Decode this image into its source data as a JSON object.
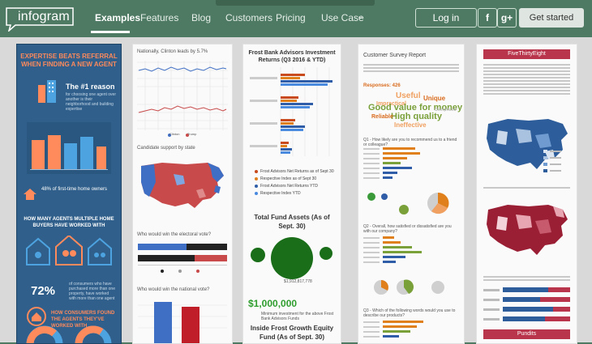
{
  "nav": {
    "logo": "infogram",
    "links": [
      "Examples",
      "Features",
      "Blog",
      "Customers",
      "Pricing",
      "Use Case"
    ],
    "login": "Log in",
    "facebook": "f",
    "google": "g+",
    "cta": "Get started"
  },
  "cards": {
    "c1": {
      "title": "EXPERTISE BEATS REFERRAL WHEN FINDING A NEW AGENT",
      "reason": "The #1 reason",
      "reason_sub": "for choosing one agent over another is their neighborhood and building expertise",
      "stat48": "48% of first-time home owners",
      "how_many": "HOW MANY AGENTS MULTIPLE HOME BUYERS HAVE WORKED WITH",
      "pct72": "72%",
      "pct72_sub": "of consumers who have purchased more than one property, have worked with more than one agent",
      "how_found": "HOW CONSUMERS FOUND THE AGENTS THEY'VE WORKED WITH"
    },
    "c2": {
      "chart_title": "Nationally, Clinton leads by 5.7%",
      "map_title": "Candidate support by state",
      "electoral_title": "Who would win the electoral vote?",
      "national_title": "Who would win the national vote?",
      "legend_clinton": "Clinton",
      "legend_trump": "Trump"
    },
    "c3": {
      "title": "Frost Bank Advisors Investment Returns (Q3 2016 & YTD)",
      "legend": [
        "Frost Advisors Net Returns as of Sept 30",
        "Respective Index as of Sept 30",
        "Frost Advisors Net Returns YTD",
        "Respective Index YTD"
      ],
      "total_title": "Total Fund Assets (As of Sept. 30)",
      "big_amount": "$1,000,000",
      "big_sub": "Minimum investment for the above Frost Bank Advisors Funds",
      "growth_title": "Inside Frost Growth Equity Fund (As of Sept. 30)",
      "circle_value": "$1,912,817,778"
    },
    "c4": {
      "title": "Customer Survey Report",
      "responses": "Responses: 426",
      "words": [
        "Useful",
        "Unique",
        "Good value for money",
        "High quality",
        "Reliable",
        "Ineffective",
        "Impractical",
        "Overpriced"
      ],
      "q1": "Q1 - How likely are you to recommend us to a friend or colleague?",
      "q2": "Q2 - Overall, how satisfied or dissatisfied are you with our company?",
      "q3": "Q3 - Which of the following words would you use to describe our products?"
    },
    "c5": {
      "title": "FiveThirtyEight",
      "pundits": "Pundits"
    }
  }
}
